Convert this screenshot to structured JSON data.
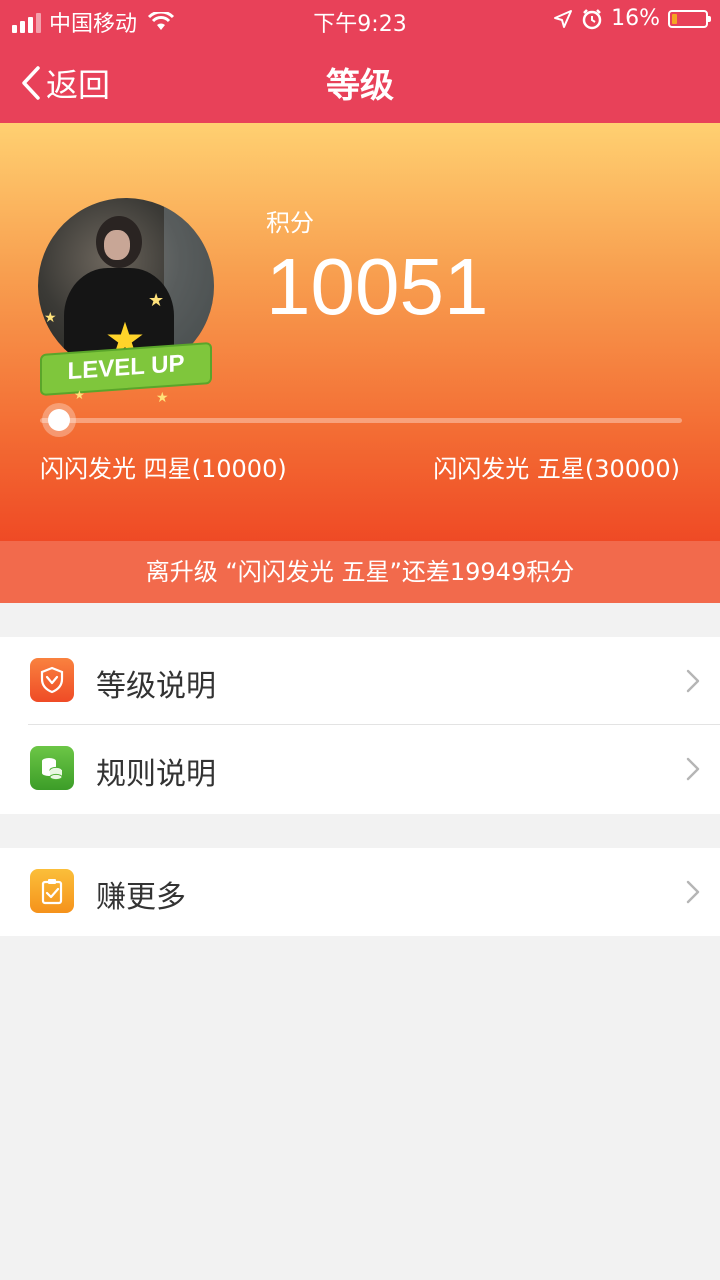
{
  "status_bar": {
    "carrier": "中国移动",
    "time": "下午9:23",
    "battery_percent": "16%",
    "battery_level": 0.16
  },
  "nav": {
    "back_label": "返回",
    "title": "等级"
  },
  "hero": {
    "badge_text": "LEVEL UP",
    "score_label": "积分",
    "score_value": "10051",
    "current_level": "闪闪发光 四星(10000)",
    "next_level": "闪闪发光 五星(30000)",
    "progress": 0.0
  },
  "upgrade_tip": "离升级 “闪闪发光 五星”还差19949积分",
  "menu": {
    "items": [
      {
        "label": "等级说明",
        "icon": "shield-icon",
        "color": "#f25f2c"
      },
      {
        "label": "规则说明",
        "icon": "coins-icon",
        "color": "#4caf32"
      }
    ],
    "more": {
      "label": "赚更多",
      "icon": "clipboard-check-icon",
      "color": "#f7a21d"
    }
  }
}
